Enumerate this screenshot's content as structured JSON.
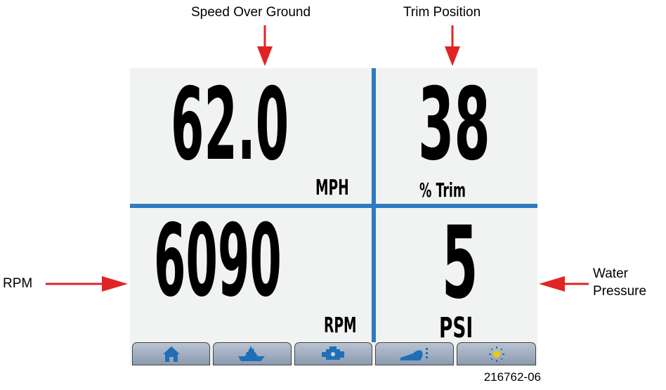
{
  "callouts": {
    "speed_over_ground": "Speed Over Ground",
    "trim_position": "Trim Position",
    "rpm": "RPM",
    "water_pressure_line1": "Water",
    "water_pressure_line2": "Pressure"
  },
  "gauges": {
    "speed": {
      "value": "62.0",
      "unit": "MPH"
    },
    "trim": {
      "value": "38",
      "unit": "% Trim"
    },
    "rpm": {
      "value": "6090",
      "unit": "RPM"
    },
    "pressure": {
      "value": "5",
      "unit": "PSI"
    }
  },
  "tabs": [
    {
      "icon": "home-icon"
    },
    {
      "icon": "boat-icon"
    },
    {
      "icon": "engine-icon"
    },
    {
      "icon": "trim-icon"
    },
    {
      "icon": "brightness-icon"
    }
  ],
  "colors": {
    "divider": "#2f7ac2",
    "arrow": "#e02424",
    "screen_bg": "#f1f3f2",
    "tab_icon": "#1f6fb8"
  },
  "figure_id": "216762-06"
}
